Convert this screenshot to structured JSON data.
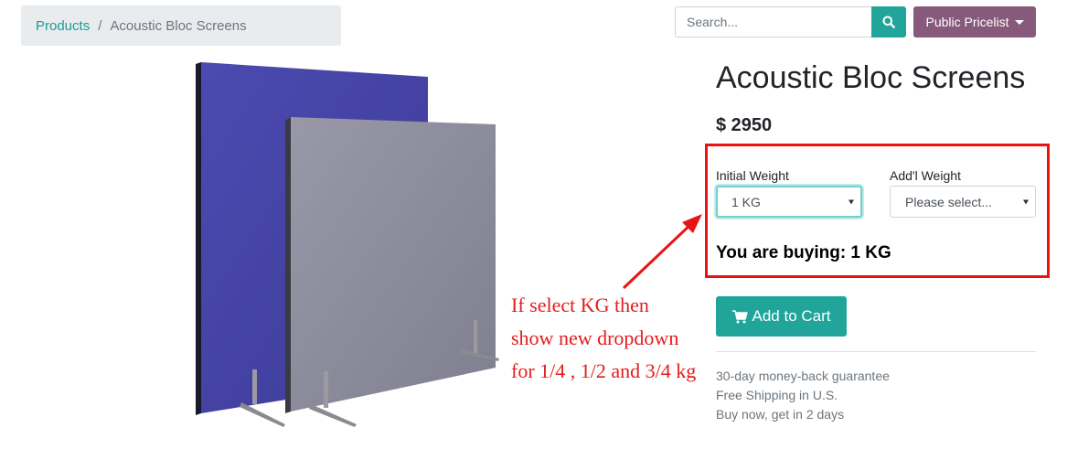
{
  "breadcrumb": {
    "home": "Products",
    "separator": "/",
    "current": "Acoustic Bloc Screens"
  },
  "search": {
    "placeholder": "Search...",
    "icon": "search-icon"
  },
  "pricelist": {
    "label": "Public Pricelist"
  },
  "product": {
    "title": "Acoustic Bloc Screens",
    "price": "$ 2950",
    "initial_weight": {
      "label": "Initial Weight",
      "value": "1 KG"
    },
    "addl_weight": {
      "label": "Add'l Weight",
      "value": "Please select..."
    },
    "buying_text": "You are buying: 1 KG",
    "add_to_cart": "Add to Cart",
    "image_colors": {
      "back_panel": "#4a49a8",
      "front_panel": "#8a8a99"
    }
  },
  "annotation": {
    "lines": [
      "If select KG then",
      "show new dropdown",
      "for 1/4 , 1/2 and 3/4 kg"
    ],
    "color": "#e31c1c"
  },
  "guarantees": [
    "30-day money-back guarantee",
    "Free Shipping in U.S.",
    "Buy now, get in 2 days"
  ],
  "colors": {
    "teal": "#21a59b",
    "purple": "#875a7b",
    "highlight": "#ee1111"
  }
}
